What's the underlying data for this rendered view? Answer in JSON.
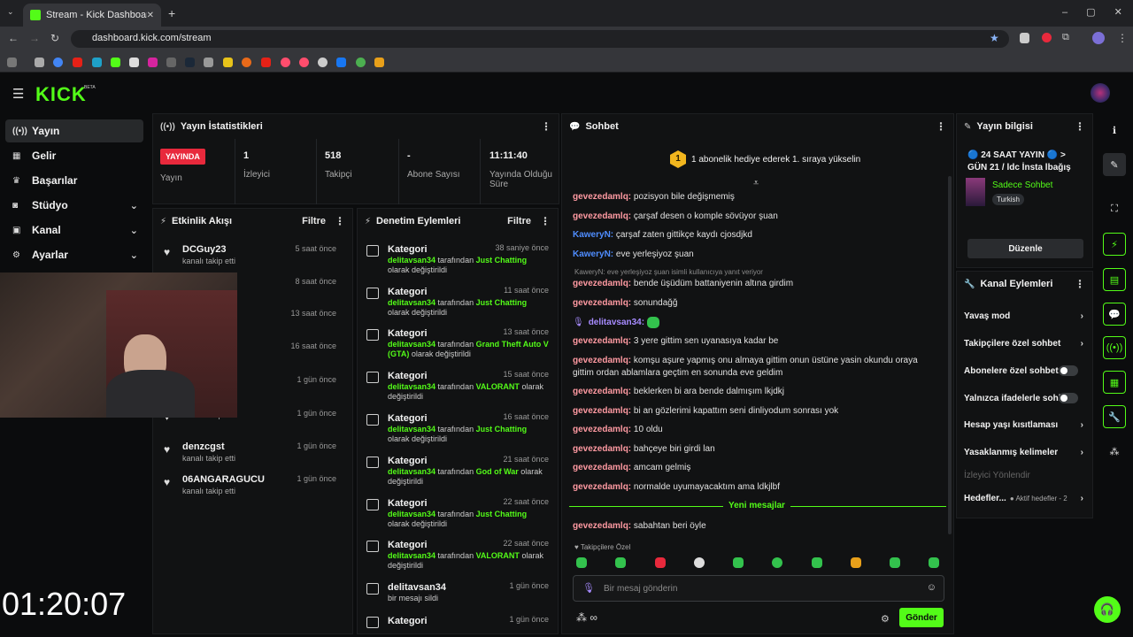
{
  "browser": {
    "tab_title": "Stream - Kick Dashboard",
    "url": "dashboard.kick.com/stream"
  },
  "logo": {
    "text": "KICK",
    "badge": "BETA"
  },
  "nav": [
    {
      "label": "Yayın",
      "icon": "broadcast-icon"
    },
    {
      "label": "Gelir",
      "icon": "chart-icon"
    },
    {
      "label": "Başarılar",
      "icon": "trophy-icon"
    },
    {
      "label": "Stüdyo",
      "icon": "camera-icon"
    },
    {
      "label": "Kanal",
      "icon": "tv-icon"
    },
    {
      "label": "Ayarlar",
      "icon": "gear-icon"
    }
  ],
  "stats": {
    "title": "Yayın İstatistikleri",
    "live_badge": "YAYINDA",
    "live_label": "Yayın",
    "viewers_value": "1",
    "viewers_label": "İzleyici",
    "followers_value": "518",
    "followers_label": "Takipçi",
    "subs_value": "-",
    "subs_label": "Abone Sayısı",
    "uptime_value": "11:11:40",
    "uptime_label": "Yayında Olduğu Süre"
  },
  "activity": {
    "title": "Etkinlik Akışı",
    "filter": "Filtre",
    "items": [
      {
        "name": "DCGuy23",
        "sub": "kanalı takip etti",
        "time": "5 saat önce"
      },
      {
        "name": "",
        "sub": "",
        "time": "8 saat önce"
      },
      {
        "name": "",
        "sub": "",
        "time": "13 saat önce"
      },
      {
        "name": "",
        "sub": "",
        "time": "16 saat önce"
      },
      {
        "name": "",
        "sub": "",
        "time": "1 gün önce"
      },
      {
        "name": "",
        "sub": "kanalı takip etti",
        "time": "1 gün önce"
      },
      {
        "name": "denzcgst",
        "sub": "kanalı takip etti",
        "time": "1 gün önce"
      },
      {
        "name": "06ANGARAGUCU",
        "sub": "kanalı takip etti",
        "time": "1 gün önce"
      }
    ]
  },
  "moderation": {
    "title": "Denetim Eylemleri",
    "filter": "Filtre",
    "items": [
      {
        "title": "Kategori",
        "user": "delitavsan34",
        "mid": "tarafından",
        "value": "Just Chatting",
        "tail": "olarak değiştirildi",
        "time": "38 saniye önce"
      },
      {
        "title": "Kategori",
        "user": "delitavsan34",
        "mid": "tarafından",
        "value": "Just Chatting",
        "tail": "olarak değiştirildi",
        "time": "11 saat önce"
      },
      {
        "title": "Kategori",
        "user": "delitavsan34",
        "mid": "tarafından",
        "value": "Grand Theft Auto V (GTA)",
        "tail": "olarak değiştirildi",
        "time": "13 saat önce"
      },
      {
        "title": "Kategori",
        "user": "delitavsan34",
        "mid": "tarafından",
        "value": "VALORANT",
        "tail": "olarak değiştirildi",
        "time": "15 saat önce"
      },
      {
        "title": "Kategori",
        "user": "delitavsan34",
        "mid": "tarafından",
        "value": "Just Chatting",
        "tail": "olarak değiştirildi",
        "time": "16 saat önce"
      },
      {
        "title": "Kategori",
        "user": "delitavsan34",
        "mid": "tarafından",
        "value": "God of War",
        "tail": "olarak değiştirildi",
        "time": "21 saat önce"
      },
      {
        "title": "Kategori",
        "user": "delitavsan34",
        "mid": "tarafından",
        "value": "Just Chatting",
        "tail": "olarak değiştirildi",
        "time": "22 saat önce"
      },
      {
        "title": "Kategori",
        "user": "delitavsan34",
        "mid": "tarafından",
        "value": "VALORANT",
        "tail": "olarak değiştirildi",
        "time": "22 saat önce"
      },
      {
        "title": "delitavsan34",
        "user": "",
        "mid": "bir mesajı sildi",
        "value": "",
        "tail": "",
        "time": "1 gün önce"
      },
      {
        "title": "Kategori",
        "user": "",
        "mid": "",
        "value": "",
        "tail": "",
        "time": "1 gün önce"
      }
    ]
  },
  "chat": {
    "title": "Sohbet",
    "banner": "1 abonelik hediye ederek 1. sıraya yükselin",
    "banner_num": "1",
    "reply_hint": "KaweryN: eve yerleşiyoz şuan isimli kullanıcıya yanıt veriyor",
    "new_messages": "Yeni mesajlar",
    "followers_only": "Takipçilere Özel",
    "input_placeholder": "Bir mesaj gönderin",
    "send": "Gönder",
    "messages": [
      {
        "user": "gevezedamlq:",
        "text": "pozisyon bile değişmemiş"
      },
      {
        "user": "gevezedamlq:",
        "text": "çarşaf desen o komple sövüyor şuan"
      },
      {
        "user": "KaweryN:",
        "text": "çarşaf zaten gittikçe kaydı cjosdjkd"
      },
      {
        "user": "KaweryN:",
        "text": "eve yerleşiyoz şuan"
      },
      {
        "user": "gevezedamlq:",
        "text": "bende üşüdüm battaniyenin altına girdim"
      },
      {
        "user": "gevezedamlq:",
        "text": "sonundağğ"
      },
      {
        "user": "delitavsan34:",
        "text": ""
      },
      {
        "user": "gevezedamlq:",
        "text": "3 yere gittim sen uyanasıya kadar be"
      },
      {
        "user": "gevezedamlq:",
        "text": "komşu aşure yapmış onu almaya gittim onun üstüne yasin okundu oraya gittim ordan ablamlara geçtim en sonunda eve geldim"
      },
      {
        "user": "gevezedamlq:",
        "text": "beklerken bi ara bende dalmışım lkjdkj"
      },
      {
        "user": "gevezedamlq:",
        "text": "bi an gözlerimi kapattım seni dinliyodum sonrası yok"
      },
      {
        "user": "gevezedamlq:",
        "text": "10 oldu"
      },
      {
        "user": "gevezedamlq:",
        "text": "bahçeye biri girdi lan"
      },
      {
        "user": "gevezedamlq:",
        "text": "amcam gelmiş"
      },
      {
        "user": "gevezedamlq:",
        "text": "normalde uyumayacaktım ama ldkjlbf"
      },
      {
        "user": "gevezedamlq:",
        "text": "sabahtan beri öyle"
      }
    ]
  },
  "info": {
    "title": "Yayın bilgisi",
    "stream_title": "🔵 24 SAAT YAYIN 🔵 > GÜN 21 / ldc İnsta lbağış",
    "category": "Sadece Sohbet",
    "language": "Turkish",
    "edit": "Düzenle"
  },
  "channel_actions": {
    "title": "Kanal Eylemleri",
    "slow": "Yavaş mod",
    "followers_chat": "Takipçilere özel sohbet",
    "subs_chat": "Abonelere özel sohbet",
    "emotes_chat": "Yalnızca ifadelerle sohbet",
    "age": "Hesap yaşı kısıtlaması",
    "banned": "Yasaklanmış kelimeler",
    "redirect": "İzleyici Yönlendir",
    "goals": "Hedefler...",
    "goals_sub": "Aktif hedefler - 2"
  },
  "overlay_clock": "01:20:07",
  "colors": {
    "accent": "#53fc18",
    "live": "#e8293c"
  }
}
